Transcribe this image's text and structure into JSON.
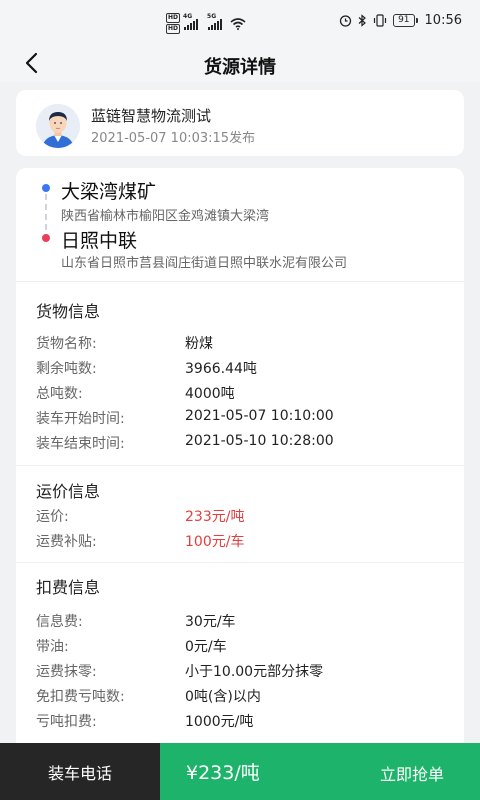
{
  "status_bar": {
    "hd1": "HD",
    "hd2": "HD",
    "net1": "4G",
    "net2": "5G",
    "battery": "91",
    "time": "10:56",
    "icons": [
      "alarm-icon",
      "bluetooth-icon",
      "vibrate-icon",
      "wifi-icon",
      "signal-icon"
    ]
  },
  "nav": {
    "back_icon": "chevron-left-icon",
    "title": "货源详情"
  },
  "publisher": {
    "name": "蓝链智慧物流测试",
    "time": "2021-05-07 10:03:15发布"
  },
  "route": {
    "from_city": "大梁湾煤矿",
    "from_address": "陕西省榆林市榆阳区金鸡滩镇大梁湾",
    "to_city": "日照中联",
    "to_address": "山东省日照市莒县阎庄街道日照中联水泥有限公司"
  },
  "cargo": {
    "title": "货物信息",
    "rows": [
      {
        "label": "货物名称:",
        "value": "粉煤"
      },
      {
        "label": "剩余吨数:",
        "value": "3966.44吨"
      },
      {
        "label": "总吨数:",
        "value": "4000吨"
      },
      {
        "label": "装车开始时间:",
        "value": "2021-05-07 10:10:00"
      },
      {
        "label": "装车结束时间:",
        "value": "2021-05-10 10:28:00"
      }
    ]
  },
  "freight": {
    "title": "运价信息",
    "rows": [
      {
        "label": "运价:",
        "value": "233元/吨"
      },
      {
        "label": "运费补贴:",
        "value": "100元/车"
      }
    ]
  },
  "deduction": {
    "title": "扣费信息",
    "rows": [
      {
        "label": "信息费:",
        "value": "30元/车"
      },
      {
        "label": "带油:",
        "value": "0元/车"
      },
      {
        "label": "运费抹零:",
        "value": "小于10.00元部分抹零"
      },
      {
        "label": "免扣费亏吨数:",
        "value": "0吨(含)以内"
      },
      {
        "label": "亏吨扣费:",
        "value": "1000元/吨"
      }
    ]
  },
  "bottom": {
    "call_label": "装车电话",
    "price": "¥233/吨",
    "grab_label": "立即抢单"
  },
  "colors": {
    "accent_green": "#1db36a",
    "dark": "#262626",
    "price_red": "#e53e3e",
    "origin_blue": "#3a78f2",
    "dest_red": "#e8405a"
  }
}
